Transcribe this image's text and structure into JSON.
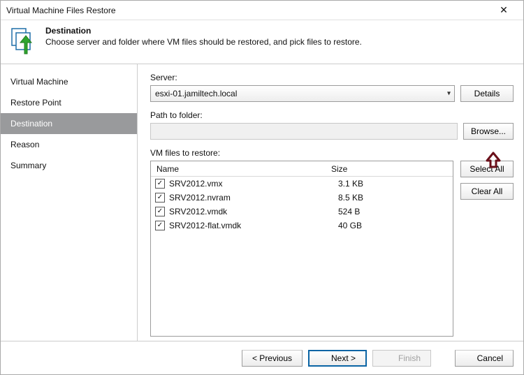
{
  "window": {
    "title": "Virtual Machine Files Restore"
  },
  "header": {
    "title": "Destination",
    "description": "Choose server and folder where VM files should be restored, and pick files to restore."
  },
  "sidebar": {
    "items": [
      {
        "label": "Virtual Machine",
        "selected": false
      },
      {
        "label": "Restore Point",
        "selected": false
      },
      {
        "label": "Destination",
        "selected": true
      },
      {
        "label": "Reason",
        "selected": false
      },
      {
        "label": "Summary",
        "selected": false
      }
    ]
  },
  "form": {
    "server_label": "Server:",
    "server_value": "esxi-01.jamiltech.local",
    "details_btn": "Details",
    "path_label": "Path to folder:",
    "path_value": "",
    "browse_btn": "Browse...",
    "files_label": "VM files to restore:",
    "col_name": "Name",
    "col_size": "Size",
    "select_all": "Select All",
    "clear_all": "Clear All",
    "rows": [
      {
        "name": "SRV2012.vmx",
        "size": "3.1 KB",
        "checked": true
      },
      {
        "name": "SRV2012.nvram",
        "size": "8.5 KB",
        "checked": true
      },
      {
        "name": "SRV2012.vmdk",
        "size": "524 B",
        "checked": true
      },
      {
        "name": "SRV2012-flat.vmdk",
        "size": "40 GB",
        "checked": true
      }
    ]
  },
  "footer": {
    "previous": "< Previous",
    "next": "Next >",
    "finish": "Finish",
    "cancel": "Cancel"
  }
}
